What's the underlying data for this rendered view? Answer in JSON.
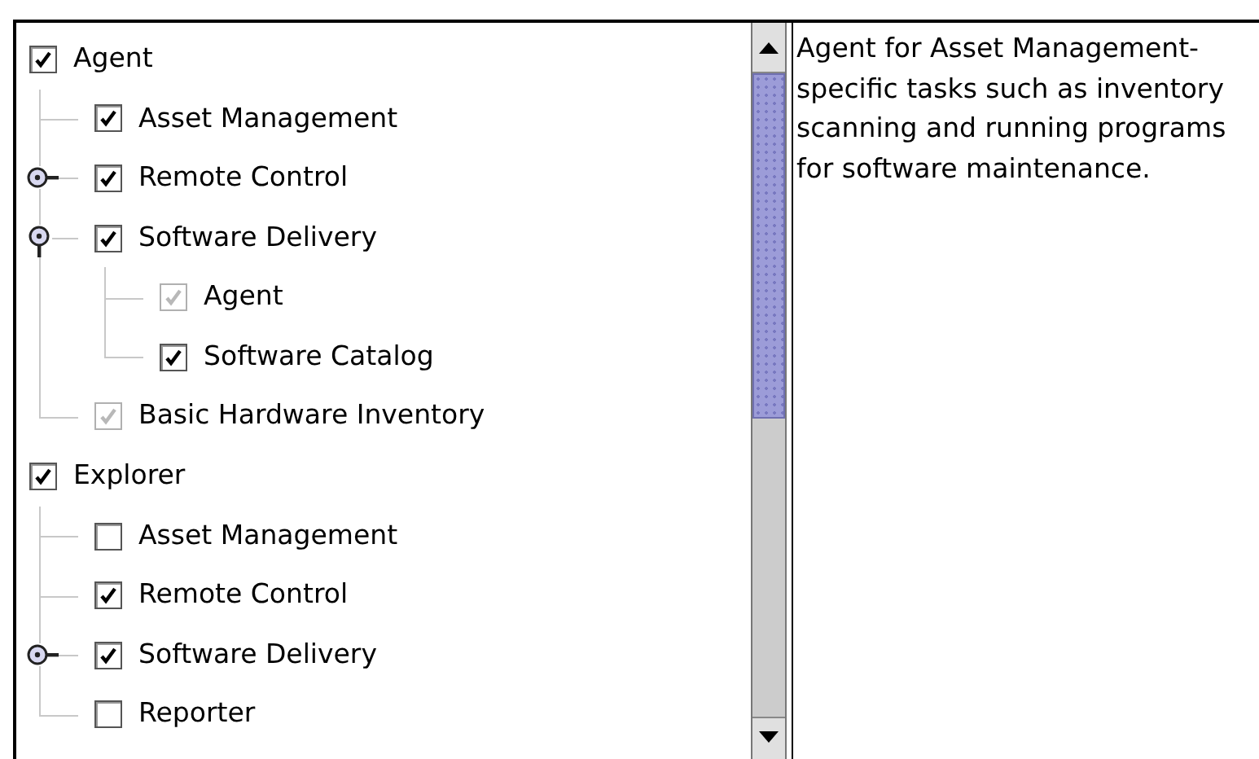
{
  "tree": [
    {
      "label": "Agent",
      "checked": true,
      "disabled": false,
      "children": [
        {
          "label": "Asset Management",
          "checked": true,
          "disabled": false
        },
        {
          "label": "Remote Control",
          "checked": true,
          "disabled": false,
          "expanded": false
        },
        {
          "label": "Software Delivery",
          "checked": true,
          "disabled": false,
          "expanded": true,
          "children": [
            {
              "label": "Agent",
              "checked": true,
              "disabled": true
            },
            {
              "label": "Software Catalog",
              "checked": true,
              "disabled": false
            }
          ]
        },
        {
          "label": "Basic Hardware Inventory",
          "checked": true,
          "disabled": true
        }
      ]
    },
    {
      "label": "Explorer",
      "checked": true,
      "disabled": false,
      "children": [
        {
          "label": "Asset Management",
          "checked": false,
          "disabled": false
        },
        {
          "label": "Remote Control",
          "checked": true,
          "disabled": false
        },
        {
          "label": "Software Delivery",
          "checked": true,
          "disabled": false,
          "expanded": false
        },
        {
          "label": "Reporter",
          "checked": false,
          "disabled": false
        }
      ]
    }
  ],
  "description": "Agent for Asset Management-specific tasks such as inventory scanning and running programs for software maintenance."
}
